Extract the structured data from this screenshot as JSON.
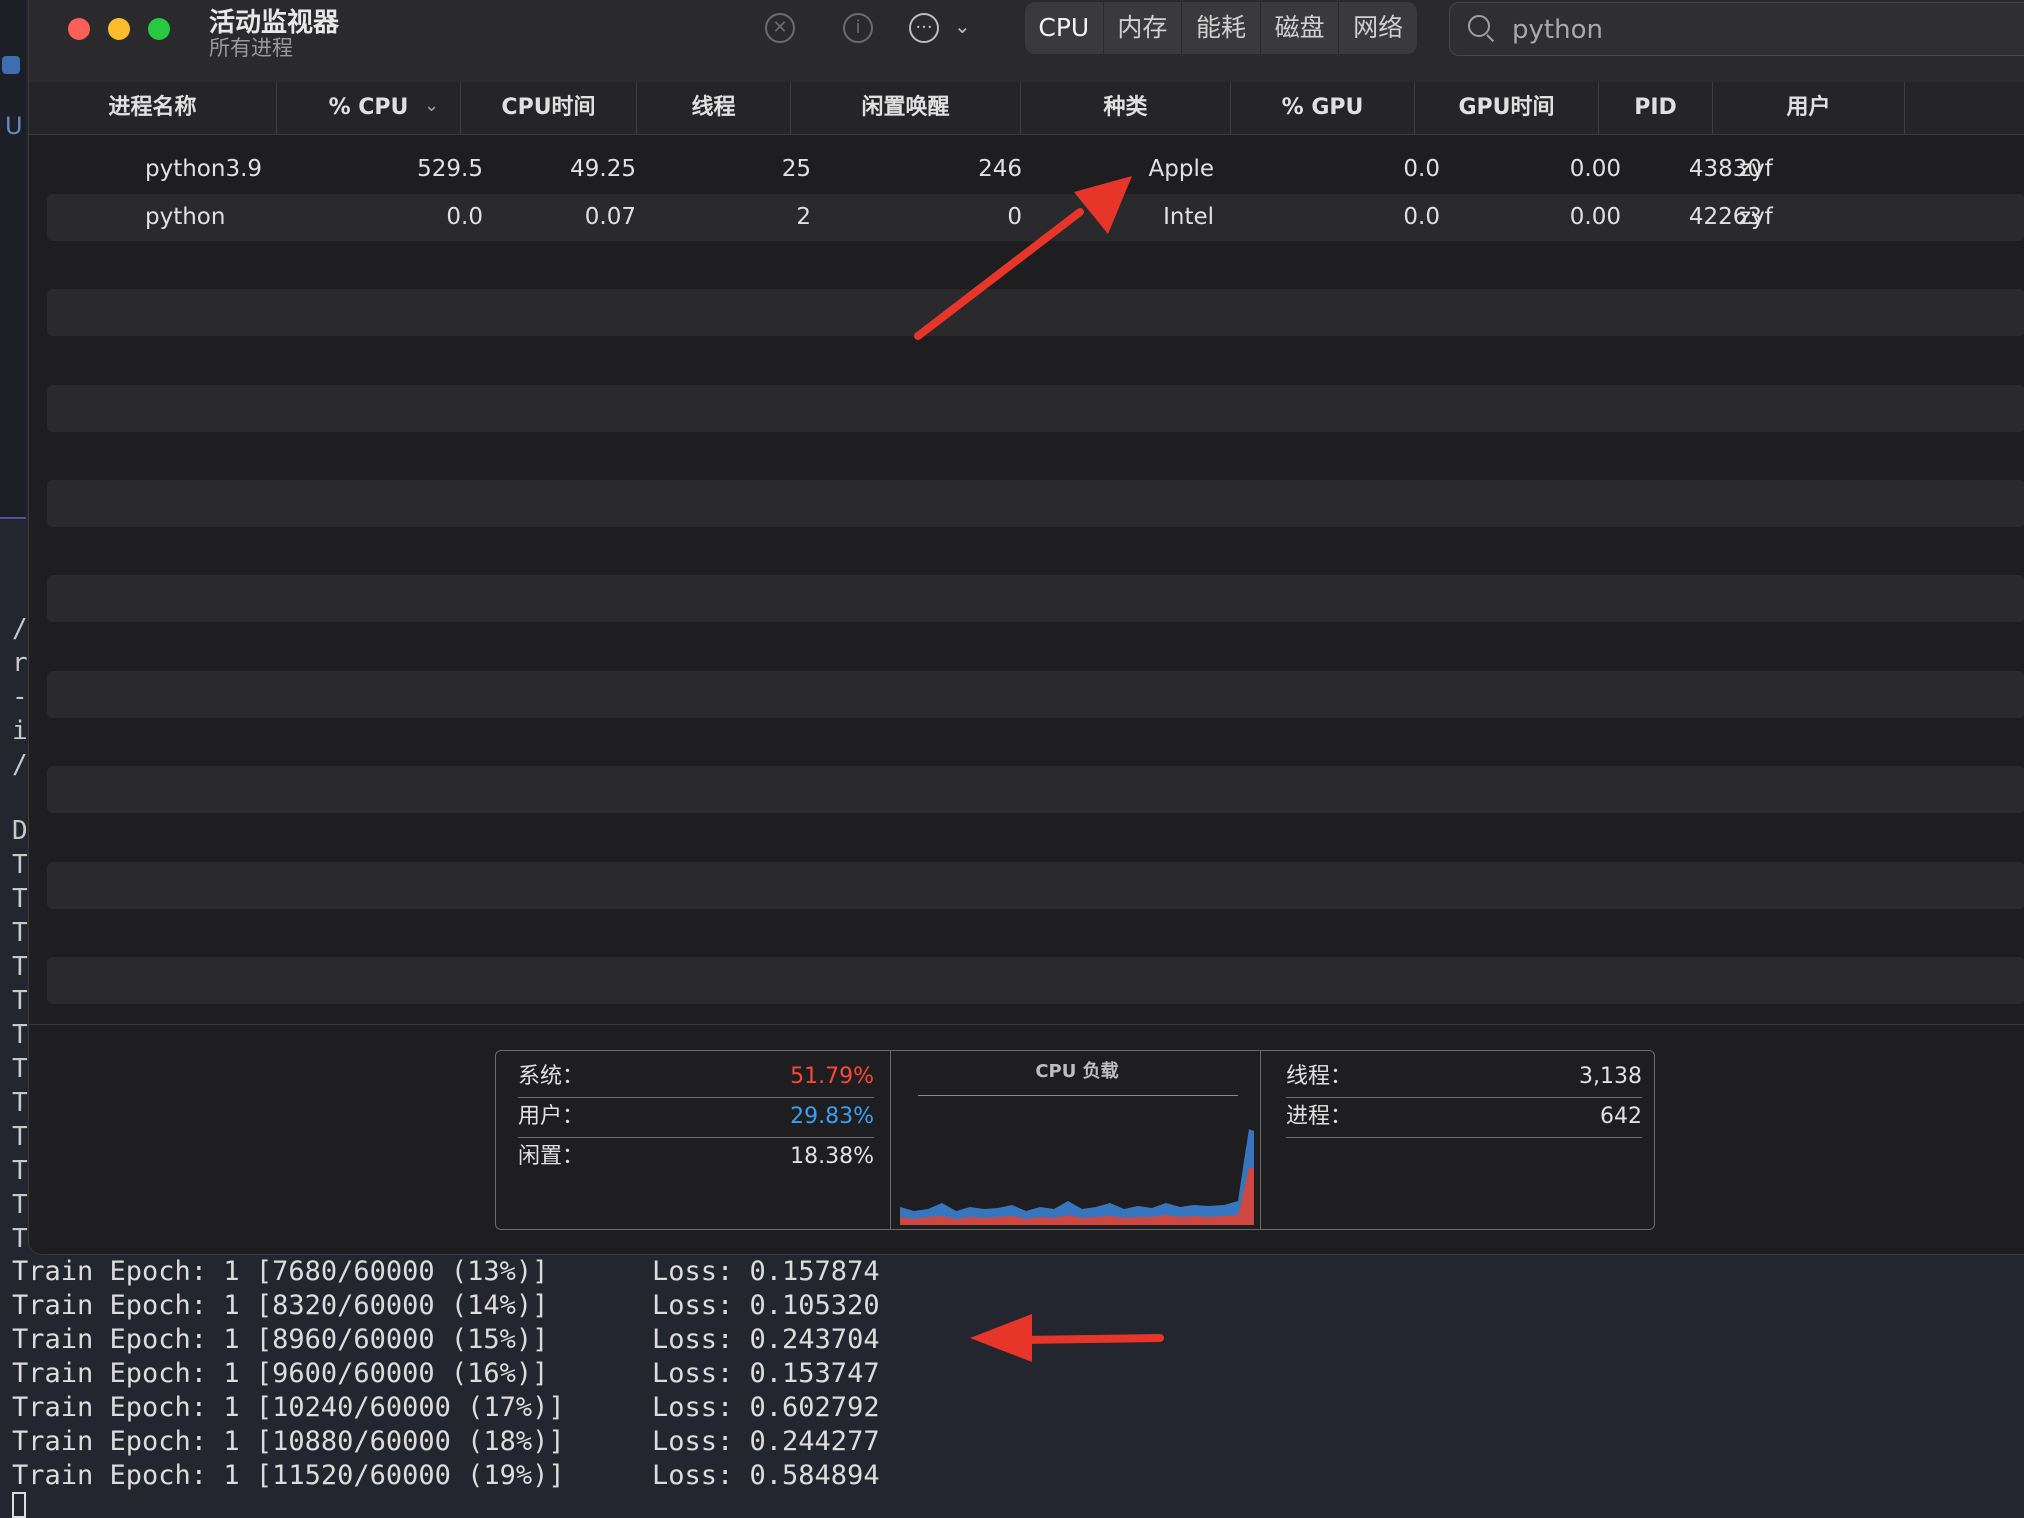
{
  "window": {
    "title": "活动监视器",
    "subtitle": "所有进程"
  },
  "toolbar": {
    "tabs": [
      "CPU",
      "内存",
      "能耗",
      "磁盘",
      "网络"
    ],
    "active_tab": "CPU",
    "search_value": "python",
    "icons": [
      "stop-process-icon",
      "info-icon",
      "more-actions-icon",
      "chevron-down-icon",
      "search-icon"
    ]
  },
  "table": {
    "columns": [
      "进程名称",
      "% CPU",
      "CPU时间",
      "线程",
      "闲置唤醒",
      "种类",
      "% GPU",
      "GPU时间",
      "PID",
      "用户"
    ],
    "sort_column": "% CPU",
    "rows": [
      {
        "name": "python3.9",
        "cpu": "529.5",
        "cpu_time": "49.25",
        "threads": "25",
        "idle_wakeups": "246",
        "kind": "Apple",
        "gpu": "0.0",
        "gpu_time": "0.00",
        "pid": "43830",
        "user": "zyf"
      },
      {
        "name": "python",
        "cpu": "0.0",
        "cpu_time": "0.07",
        "threads": "2",
        "idle_wakeups": "0",
        "kind": "Intel",
        "gpu": "0.0",
        "gpu_time": "0.00",
        "pid": "42263",
        "user": "zyf"
      }
    ]
  },
  "footer": {
    "system_label": "系统：",
    "system_value": "51.79%",
    "user_label": "用户：",
    "user_value": "29.83%",
    "idle_label": "闲置：",
    "idle_value": "18.38%",
    "graph_title": "CPU 负载",
    "threads_label": "线程：",
    "threads_value": "3,138",
    "processes_label": "进程：",
    "processes_value": "642",
    "colors": {
      "system": "#ff453a",
      "user": "#3a9ff5"
    }
  },
  "terminal": {
    "left_chars": [
      "/",
      "r",
      "-",
      "i",
      "/",
      "D",
      "T",
      "T",
      "T",
      "T",
      "T",
      "T",
      "T",
      "T",
      "T",
      "T",
      "T",
      "T"
    ],
    "lines": [
      {
        "text": "Train Epoch: 1 [7680/60000 (13%)]",
        "loss": "Loss: 0.157874"
      },
      {
        "text": "Train Epoch: 1 [8320/60000 (14%)]",
        "loss": "Loss: 0.105320"
      },
      {
        "text": "Train Epoch: 1 [8960/60000 (15%)]",
        "loss": "Loss: 0.243704"
      },
      {
        "text": "Train Epoch: 1 [9600/60000 (16%)]",
        "loss": "Loss: 0.153747"
      },
      {
        "text": "Train Epoch: 1 [10240/60000 (17%)]",
        "loss": "Loss: 0.602792"
      },
      {
        "text": "Train Epoch: 1 [10880/60000 (18%)]",
        "loss": "Loss: 0.244277"
      },
      {
        "text": "Train Epoch: 1 [11520/60000 (19%)]",
        "loss": "Loss: 0.584894"
      }
    ]
  },
  "editor": {
    "gutter_letter": "U"
  }
}
